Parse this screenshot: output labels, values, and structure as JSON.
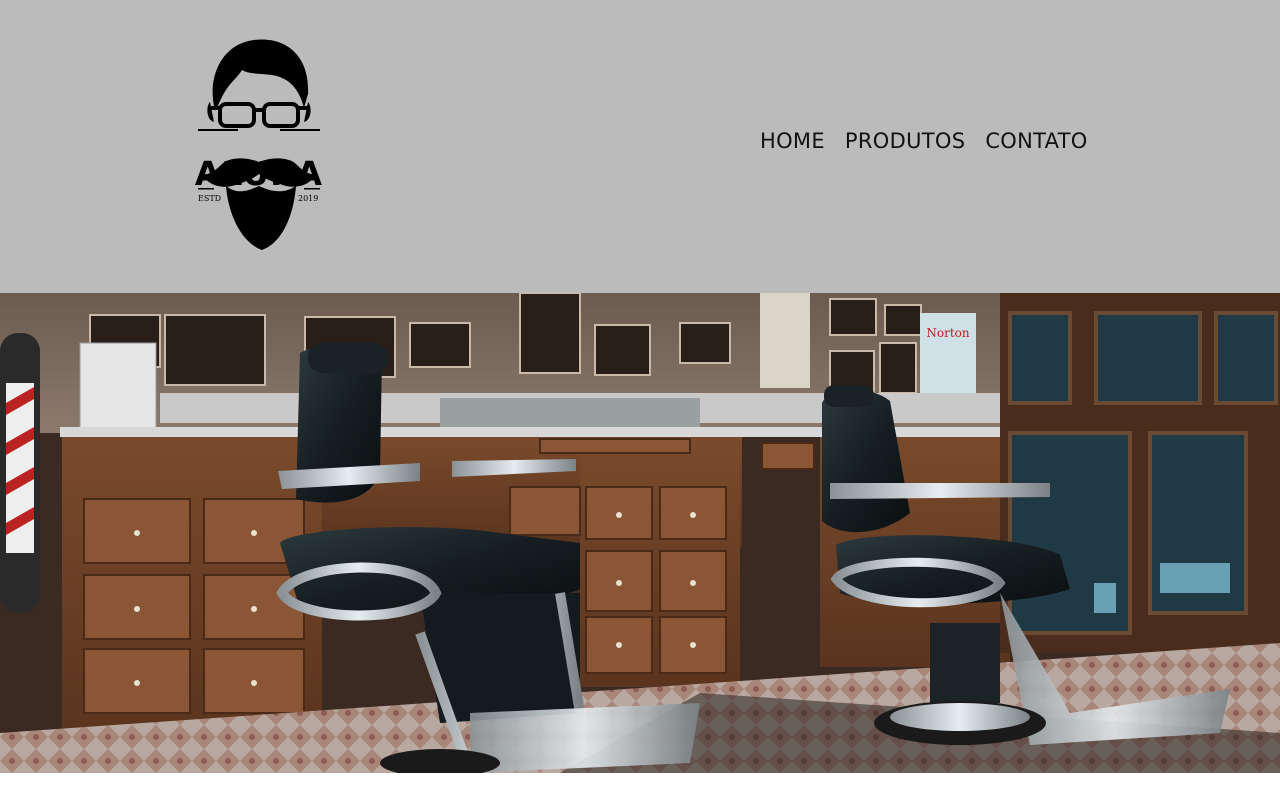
{
  "header": {
    "logo": {
      "wordmark": "ALURA",
      "estd": "ESTD",
      "year": "2019",
      "icon": "bearded-man-glasses-icon"
    },
    "nav": {
      "items": [
        {
          "label": "HOME"
        },
        {
          "label": "PRODUTOS"
        },
        {
          "label": "CONTATO"
        }
      ]
    }
  },
  "banner": {
    "alt": "barbershop-interior-photo",
    "poster_text": "Norton"
  },
  "colors": {
    "header_bg": "#bbbbbb",
    "nav_text": "#111111",
    "page_bg": "#ffffff"
  }
}
